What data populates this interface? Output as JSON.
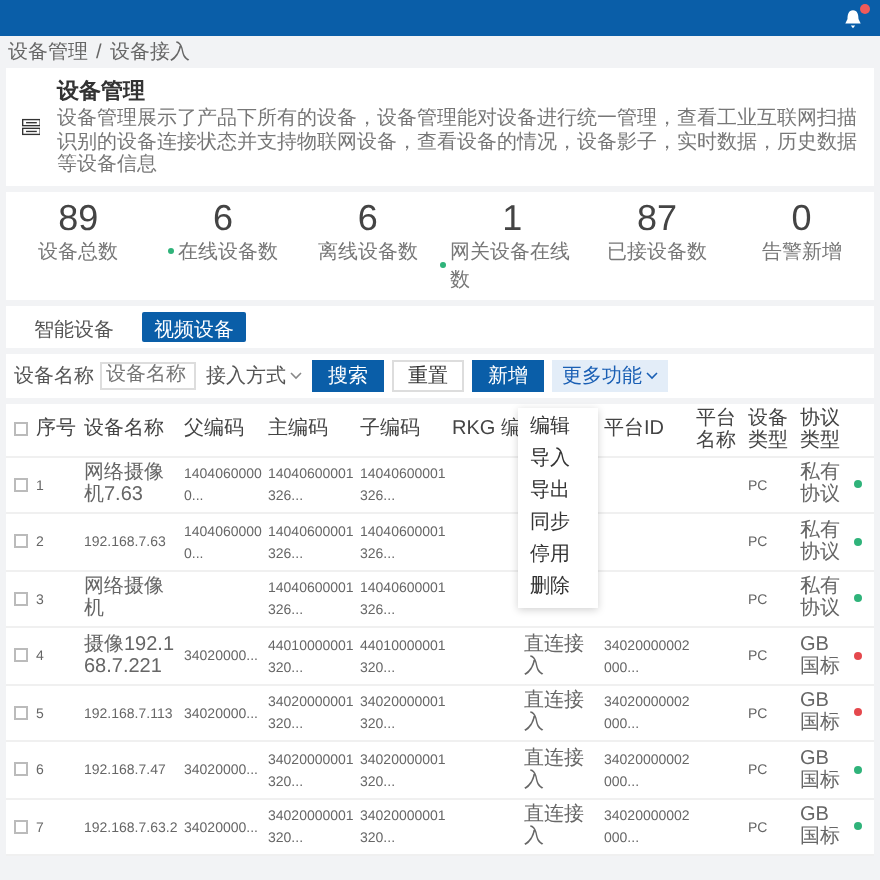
{
  "breadcrumb": [
    "设备管理",
    "设备接入"
  ],
  "breadcrumb_separator": "/",
  "header": {
    "title": "设备管理",
    "description": "设备管理展示了产品下所有的设备，设备管理能对设备进行统一管理，查看工业互联网扫描识别的设备连接状态并支持物联网设备，查看设备的情况，设备影子，实时数据，历史数据等设备信息"
  },
  "notification": {
    "badge": true
  },
  "stats": [
    {
      "value": "89",
      "label": "设备总数"
    },
    {
      "value": "6",
      "label": "在线设备数",
      "color": "#2fb37a"
    },
    {
      "value": "6",
      "label": "离线设备数"
    },
    {
      "value": "1",
      "label": "网关设备在线数",
      "color": "#2fb37a"
    },
    {
      "value": "87",
      "label": "已接设备数"
    },
    {
      "value": "0",
      "label": "告警新增"
    }
  ],
  "tabs": [
    {
      "label": "智能设备",
      "selected": false
    },
    {
      "label": "视频设备",
      "selected": true
    }
  ],
  "filter": {
    "label": "设备名称",
    "placeholder": "设备名称",
    "select": "接入方式"
  },
  "buttons": [
    {
      "label": "搜索",
      "kind": "primary"
    },
    {
      "label": "重置",
      "kind": "plain"
    },
    {
      "label": "新增",
      "kind": "primary"
    },
    {
      "label": "更多功能",
      "kind": "light"
    }
  ],
  "menu": [
    "编辑",
    "导入",
    "导出",
    "同步",
    "停用",
    "删除"
  ],
  "table": {
    "header_checked": false,
    "columns": [
      "序号",
      "设备名称",
      "父编码",
      "主编码",
      "子编码",
      "RKG 编"
    ],
    "columns_right": [
      "平台ID",
      "平台名称",
      "设备类型",
      "协议类型"
    ],
    "rows": [
      {
        "checked": false,
        "cells": [
          "1",
          "网络摄像机7.63",
          "14040600000...",
          "14040600001326...",
          "14040600001326...",
          "",
          "",
          "",
          "",
          "PC",
          "私有协议"
        ],
        "color": "#2fb37a"
      },
      {
        "checked": false,
        "cells": [
          "2",
          "192.168.7.63",
          "14040600000...",
          "14040600001326...",
          "14040600001326...",
          "",
          "",
          "",
          "",
          "PC",
          "私有协议"
        ],
        "color": "#2fb37a"
      },
      {
        "checked": false,
        "cells": [
          "3",
          "网络摄像机",
          "",
          "14040600001326...",
          "14040600001326...",
          "",
          "",
          "",
          "",
          "PC",
          "私有协议"
        ],
        "color": "#2fb37a"
      },
      {
        "checked": false,
        "cells": [
          "4",
          "摄像192.168.7.221",
          "34020000...",
          "44010000001320...",
          "44010000001320...",
          "",
          "直连接入",
          "34020000002000...",
          "",
          "PC",
          "GB 国标"
        ],
        "color": "#e5484d"
      },
      {
        "checked": false,
        "cells": [
          "5",
          "192.168.7.113",
          "34020000...",
          "34020000001320...",
          "34020000001320...",
          "",
          "直连接入",
          "34020000002000...",
          "",
          "PC",
          "GB 国标"
        ],
        "color": "#e5484d"
      },
      {
        "checked": false,
        "cells": [
          "6",
          "192.168.7.47",
          "34020000...",
          "34020000001320...",
          "34020000001320...",
          "",
          "直连接入",
          "34020000002000...",
          "",
          "PC",
          "GB 国标"
        ],
        "color": "#2fb37a"
      },
      {
        "checked": false,
        "cells": [
          "7",
          "192.168.7.63.2",
          "34020000...",
          "34020000001320...",
          "34020000001320...",
          "",
          "直连接入",
          "34020000002000...",
          "",
          "PC",
          "GB 国标"
        ],
        "color": "#2fb37a"
      }
    ]
  }
}
